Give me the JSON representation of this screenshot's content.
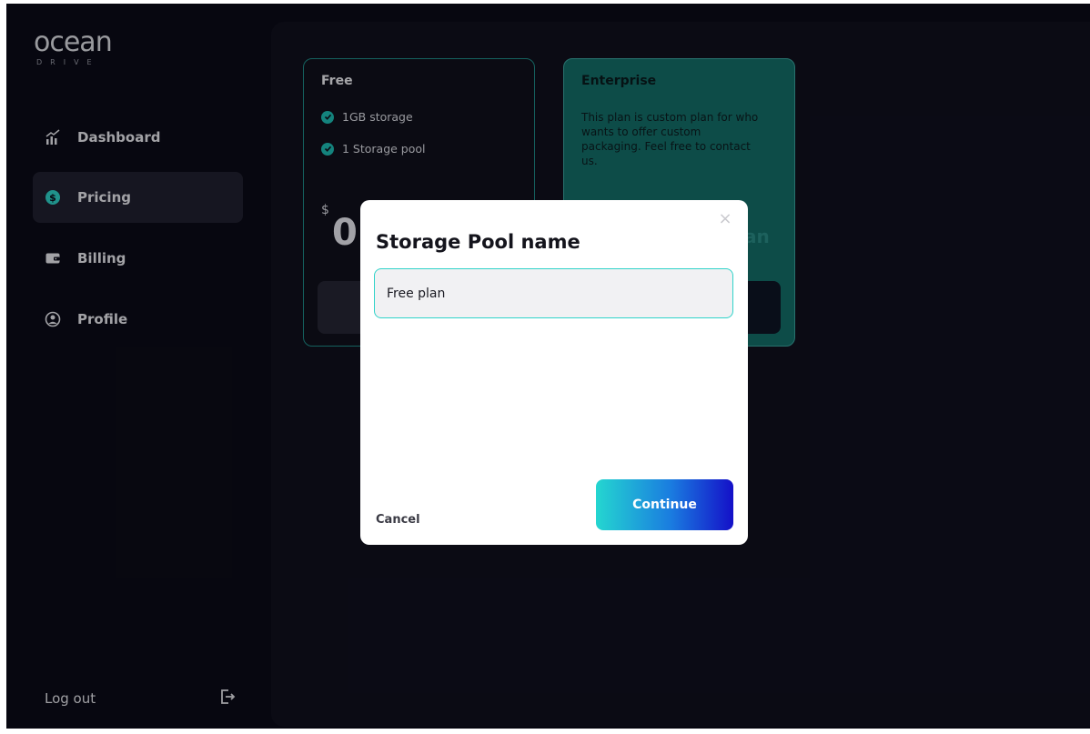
{
  "brand": {
    "logo_text": "ocean",
    "logo_sub": "DRIVE"
  },
  "sidebar": {
    "items": [
      {
        "label": "Dashboard",
        "icon": "chart-icon"
      },
      {
        "label": "Pricing",
        "icon": "dollar-icon",
        "active": true
      },
      {
        "label": "Billing",
        "icon": "wallet-icon"
      },
      {
        "label": "Profile",
        "icon": "user-circle-icon"
      }
    ],
    "logout_label": "Log out"
  },
  "plans": {
    "free": {
      "title": "Free",
      "features": [
        "1GB storage",
        "1 Storage pool"
      ],
      "currency": "$",
      "price": "0"
    },
    "enterprise": {
      "title": "Enterprise",
      "description": "This plan is custom plan for who wants to offer custom packaging. Feel free to contact us.",
      "partial_text": "an"
    }
  },
  "modal": {
    "title": "Storage Pool name",
    "input_value": "Free plan",
    "cancel_label": "Cancel",
    "continue_label": "Continue",
    "close_symbol": "×"
  },
  "colors": {
    "background": "#0b0b17",
    "accent": "#22c6c0",
    "enterprise_card": "#146e68",
    "continue_gradient_start": "#24d6d0",
    "continue_gradient_end": "#1410c8"
  }
}
